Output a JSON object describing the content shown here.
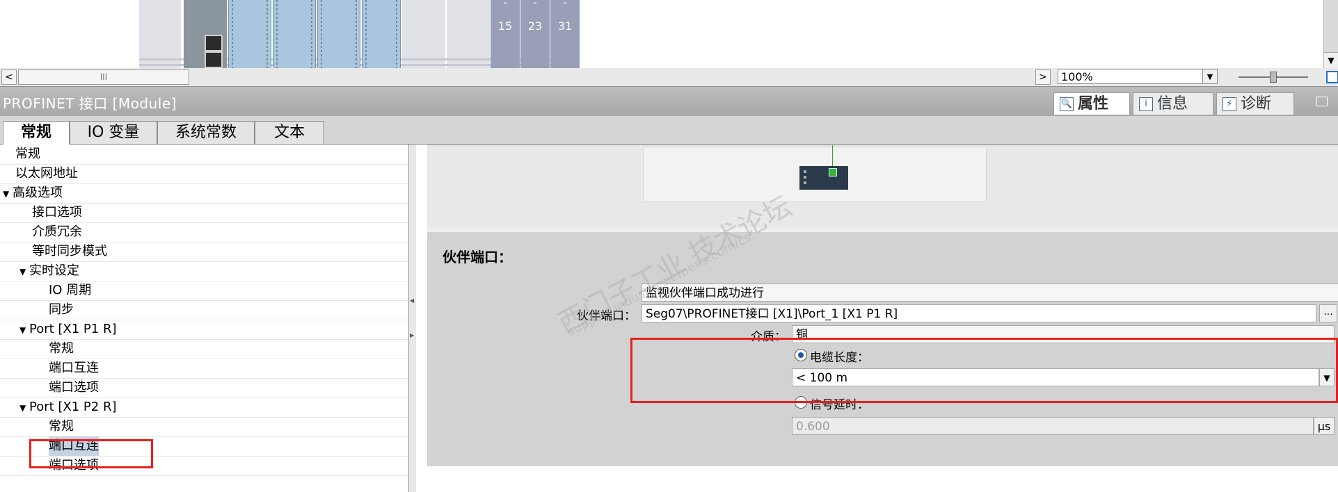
{
  "device_view": {
    "slot_columns": [
      {
        "dash": "-",
        "number": "15"
      },
      {
        "dash": "-",
        "number": "23"
      },
      {
        "dash": "-",
        "number": "31"
      }
    ]
  },
  "scroll_strip": {
    "thumb_glyph": "|||",
    "zoom_value": "100%"
  },
  "title_bar": {
    "title": "PROFINET 接口 [Module]",
    "tabs": [
      {
        "label": "属性",
        "icon": "properties-icon",
        "glyph": "🔍"
      },
      {
        "label": "信息",
        "icon": "info-icon",
        "glyph": "i"
      },
      {
        "label": "诊断",
        "icon": "diagnostics-icon",
        "glyph": "⚡"
      }
    ]
  },
  "section_tabs": [
    "常规",
    "IO 变量",
    "系统常数",
    "文本"
  ],
  "nav_tree": [
    {
      "label": "常规"
    },
    {
      "label": "以太网地址"
    },
    {
      "label": "高级选项",
      "arrow": "▼"
    },
    {
      "label": "接口选项"
    },
    {
      "label": "介质冗余"
    },
    {
      "label": "等时同步模式"
    },
    {
      "label": "实时设定",
      "arrow": "▼"
    },
    {
      "label": "IO 周期"
    },
    {
      "label": "同步"
    },
    {
      "label": "Port [X1 P1 R]",
      "arrow": "▼"
    },
    {
      "label": "常规"
    },
    {
      "label": "端口互连"
    },
    {
      "label": "端口选项"
    },
    {
      "label": "Port [X1 P2 R]",
      "arrow": "▼"
    },
    {
      "label": "常规"
    },
    {
      "label": "端口互连",
      "selected": true
    },
    {
      "label": "端口选项"
    }
  ],
  "partner_port": {
    "section_title": "伙伴端口：",
    "monitor_text": "监视伙伴端口成功进行",
    "partner_port_label": "伙伴端口：",
    "partner_port_value": "Seg07\\PROFINET接口 [X1]\\Port_1 [X1 P1 R]",
    "browse_label": "...",
    "medium_label": "介质：",
    "medium_value": "铜",
    "cable_length_label": "电缆长度：",
    "cable_length_value": "< 100 m",
    "signal_delay_label": "信号延时：",
    "signal_delay_value": "0.600",
    "signal_delay_unit": "μs"
  },
  "watermark": {
    "line1": "西门子工业  技术论坛",
    "line2": "support.industry.siemens.com/cs"
  },
  "colors": {
    "highlight": "#e8201c",
    "selected_row": "#c7d3e4",
    "title_bar": "#b3b3b3"
  }
}
